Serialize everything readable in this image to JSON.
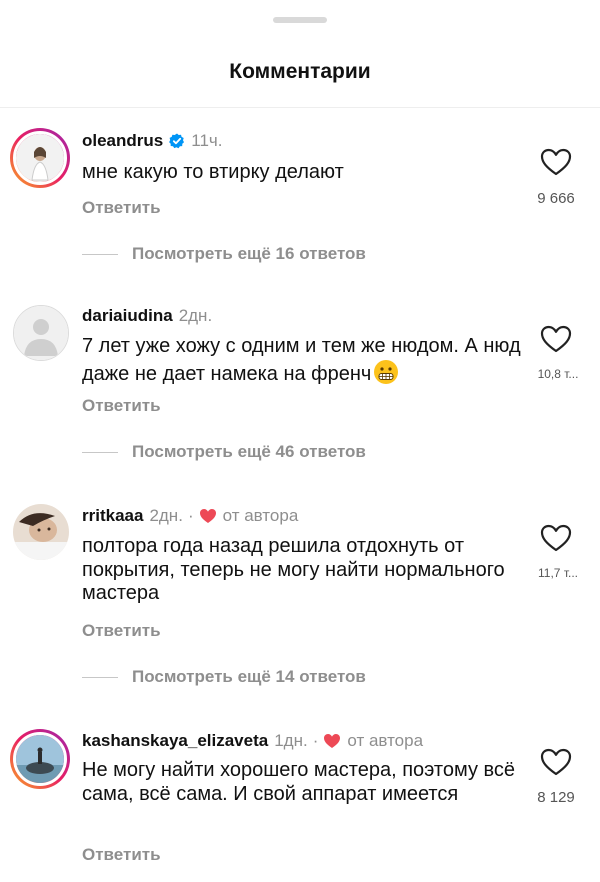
{
  "sheet": {
    "title": "Комментарии"
  },
  "comments": [
    {
      "username": "oleandrus",
      "verified": true,
      "time": "11ч.",
      "text": "мне какую то втирку делают",
      "reply_label": "Ответить",
      "likes": "9 666",
      "view_more": "Посмотреть ещё 16 ответов"
    },
    {
      "username": "dariaiudina",
      "time": "2дн.",
      "text": "7 лет уже хожу с одним и тем же нюдом. А нюд даже не дает намека на френч",
      "emoji": "grimacing-face",
      "reply_label": "Ответить",
      "likes": "10,8 т...",
      "view_more": "Посмотреть ещё 46 ответов"
    },
    {
      "username": "rritkaaa",
      "time": "2дн.",
      "separator": "·",
      "by_author": "от автора",
      "text": "полтора года назад решила отдохнуть от покрытия, теперь не могу найти нормального мастера",
      "reply_label": "Ответить",
      "likes": "11,7 т...",
      "view_more": "Посмотреть ещё 14 ответов"
    },
    {
      "username": "kashanskaya_elizaveta",
      "time": "1дн.",
      "separator": "·",
      "by_author": "от автора",
      "text": "Не могу найти хорошего мастера, поэтому всё сама, всё сама. И свой аппарат имеется",
      "reply_label": "Ответить",
      "likes": "8 129"
    }
  ],
  "colors": {
    "heart_red": "#ed4956",
    "verified_blue": "#0095f6",
    "muted": "#8e8e8e"
  }
}
